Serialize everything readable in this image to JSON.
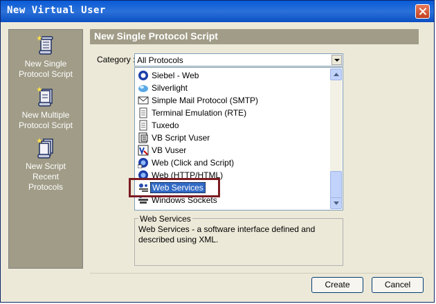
{
  "window": {
    "title": "New Virtual User"
  },
  "sidebar": {
    "items": [
      {
        "label_line1": "New Single",
        "label_line2": "Protocol Script",
        "label_line3": ""
      },
      {
        "label_line1": "New Multiple",
        "label_line2": "Protocol Script",
        "label_line3": ""
      },
      {
        "label_line1": "New Script",
        "label_line2": "Recent",
        "label_line3": "Protocols"
      }
    ]
  },
  "header": {
    "title": "New Single Protocol Script"
  },
  "category": {
    "label": "Category :",
    "selected": "All Protocols"
  },
  "protocols": [
    {
      "label": "Siebel - Web",
      "icon": "siebel-icon"
    },
    {
      "label": "Silverlight",
      "icon": "silverlight-icon"
    },
    {
      "label": "Simple Mail Protocol (SMTP)",
      "icon": "mail-icon"
    },
    {
      "label": "Terminal Emulation (RTE)",
      "icon": "document-icon"
    },
    {
      "label": "Tuxedo",
      "icon": "document-icon"
    },
    {
      "label": "VB Script Vuser",
      "icon": "script-icon"
    },
    {
      "label": "VB Vuser",
      "icon": "vb-icon"
    },
    {
      "label": "Web (Click and Script)",
      "icon": "globe-icon"
    },
    {
      "label": "Web (HTTP/HTML)",
      "icon": "globe-icon"
    },
    {
      "label": "Web Services",
      "icon": "web-services-icon",
      "selected": true
    },
    {
      "label": "Windows Sockets",
      "icon": "sockets-icon"
    }
  ],
  "description": {
    "title": "Web Services",
    "text": "Web Services - a software interface defined and described using XML."
  },
  "buttons": {
    "create": "Create",
    "cancel": "Cancel"
  },
  "colors": {
    "selection": "#316ac5",
    "highlight_box": "#7b1c22",
    "sidebar": "#a09c87"
  }
}
